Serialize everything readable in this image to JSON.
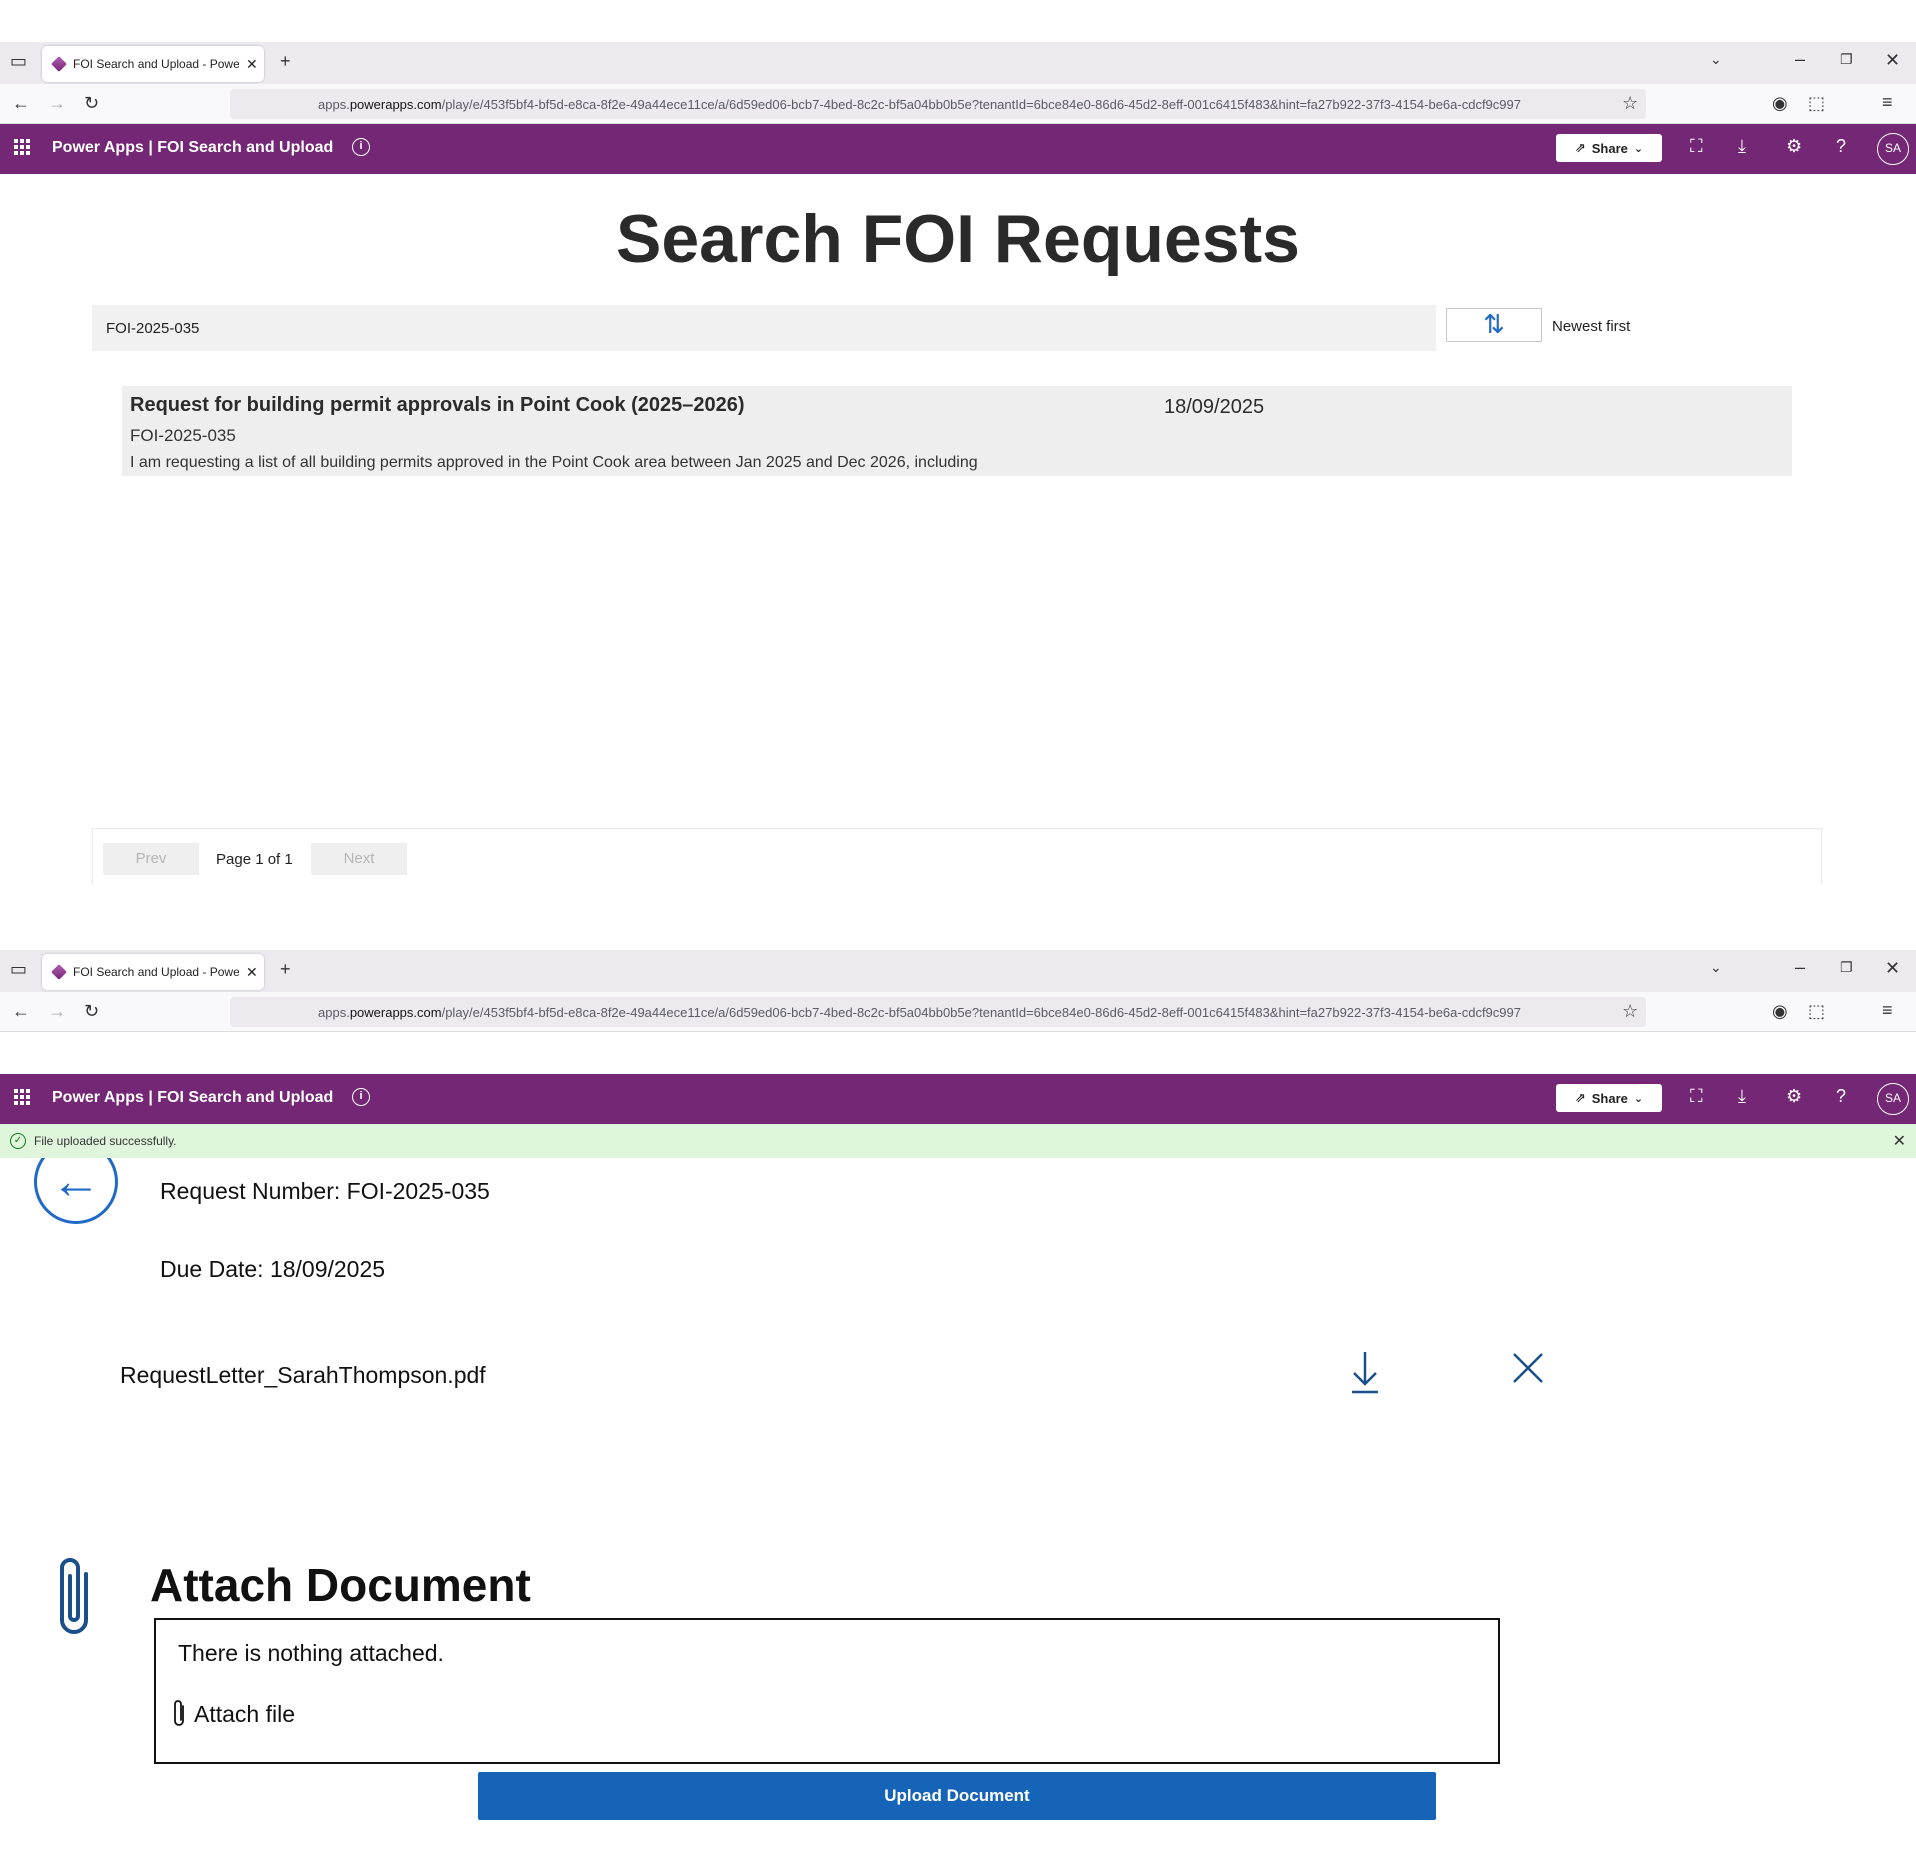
{
  "browser": {
    "tab_title": "FOI Search and Upload - Power",
    "tab_close": "✕",
    "new_tab": "+",
    "url_prefix": "apps.",
    "url_host": "powerapps.com",
    "url_rest": "/play/e/453f5bf4-bf5d-e8ca-8f2e-49a44ece11ce/a/6d59ed06-bcb7-4bed-8c2c-bf5a04bb0b5e?tenantId=6bce84e0-86d6-45d2-8eff-001c6415f483&hint=fa27b922-37f3-4154-be6a-cdcf9c997"
  },
  "app_header": {
    "brand": "Power Apps  |  FOI Search and Upload",
    "share_label": "Share",
    "avatar_initials": "SA",
    "background": "#742774"
  },
  "search_screen": {
    "title": "Search FOI Requests",
    "search_value": "FOI-2025-035",
    "sort_label": "Newest first",
    "result": {
      "title": "Request for building permit approvals in Point Cook (2025–2026)",
      "date": "18/09/2025",
      "number": "FOI-2025-035",
      "description": "I am requesting a list of all building permits approved in the Point Cook area between Jan 2025 and Dec 2026, including"
    },
    "pager": {
      "prev": "Prev",
      "page_text": "Page 1 of 1",
      "next": "Next"
    }
  },
  "detail_screen": {
    "toast": "File uploaded successfully.",
    "request_number": "Request Number: FOI-2025-035",
    "due_date": "Due Date: 18/09/2025",
    "file_name": "RequestLetter_SarahThompson.pdf",
    "attach_title": "Attach Document",
    "attach_empty": "There is nothing attached.",
    "attach_link": "Attach file",
    "upload_button": "Upload Document",
    "accent": "#1664b8"
  }
}
